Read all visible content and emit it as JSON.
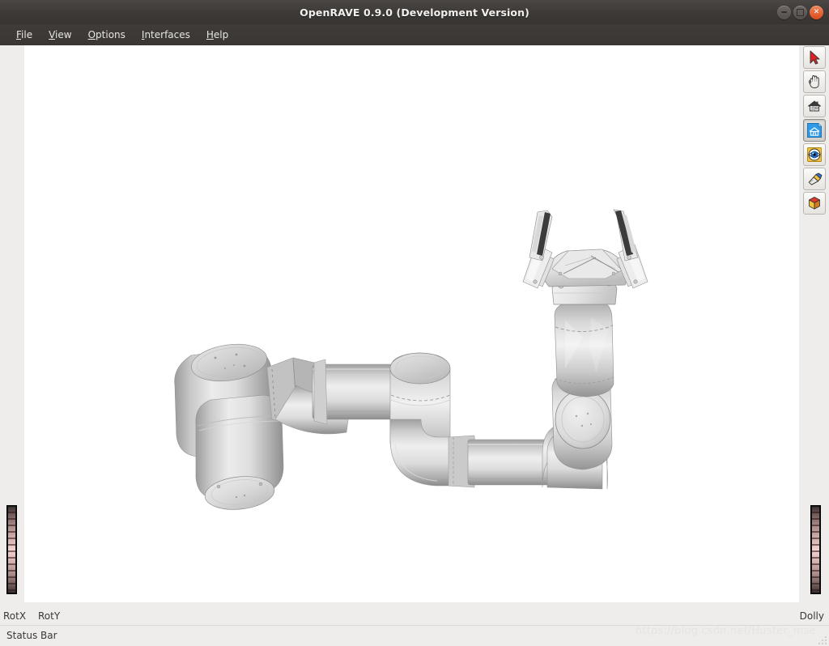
{
  "window": {
    "title": "OpenRAVE 0.9.0 (Development Version)",
    "controls": {
      "minimize": "minimize-button",
      "maximize": "maximize-button",
      "close": "close-button"
    }
  },
  "menubar": {
    "items": [
      {
        "label": "File",
        "mnemonic": "F"
      },
      {
        "label": "View",
        "mnemonic": "V"
      },
      {
        "label": "Options",
        "mnemonic": "O"
      },
      {
        "label": "Interfaces",
        "mnemonic": "I"
      },
      {
        "label": "Help",
        "mnemonic": "H"
      }
    ]
  },
  "toolbar": {
    "buttons": [
      {
        "icon": "arrow-cursor-icon",
        "name": "pick-mode-button",
        "active": false
      },
      {
        "icon": "hand-icon",
        "name": "view-mode-button",
        "active": false
      },
      {
        "icon": "home-icon",
        "name": "home-view-button",
        "active": false
      },
      {
        "icon": "set-home-icon",
        "name": "set-home-view-button",
        "active": true
      },
      {
        "icon": "view-all-eye-icon",
        "name": "view-all-button",
        "active": false
      },
      {
        "icon": "flashlight-icon",
        "name": "seek-button",
        "active": false
      },
      {
        "icon": "cube-icon",
        "name": "perspective-toggle-button",
        "active": false
      }
    ]
  },
  "viewport": {
    "name": "3d-viewport",
    "background": "#ffffff",
    "scene": "robot-manipulator-arm"
  },
  "controls": {
    "rotx_label": "RotX",
    "roty_label": "RotY",
    "dolly_label": "Dolly"
  },
  "statusbar": {
    "text": "Status Bar"
  },
  "watermark": {
    "text": "https://blog.csdn.net/Huster_mse"
  },
  "colors": {
    "titlebar": "#3d3a37",
    "menubar": "#393633",
    "close_button": "#da4a1c",
    "frame": "#efedeb",
    "viewport_bg": "#ffffff",
    "thumbwheel": "#e0bcb9",
    "robot_light": "#e8e8e8",
    "robot_mid": "#c9c9c9",
    "robot_dark": "#9a9a9a"
  }
}
